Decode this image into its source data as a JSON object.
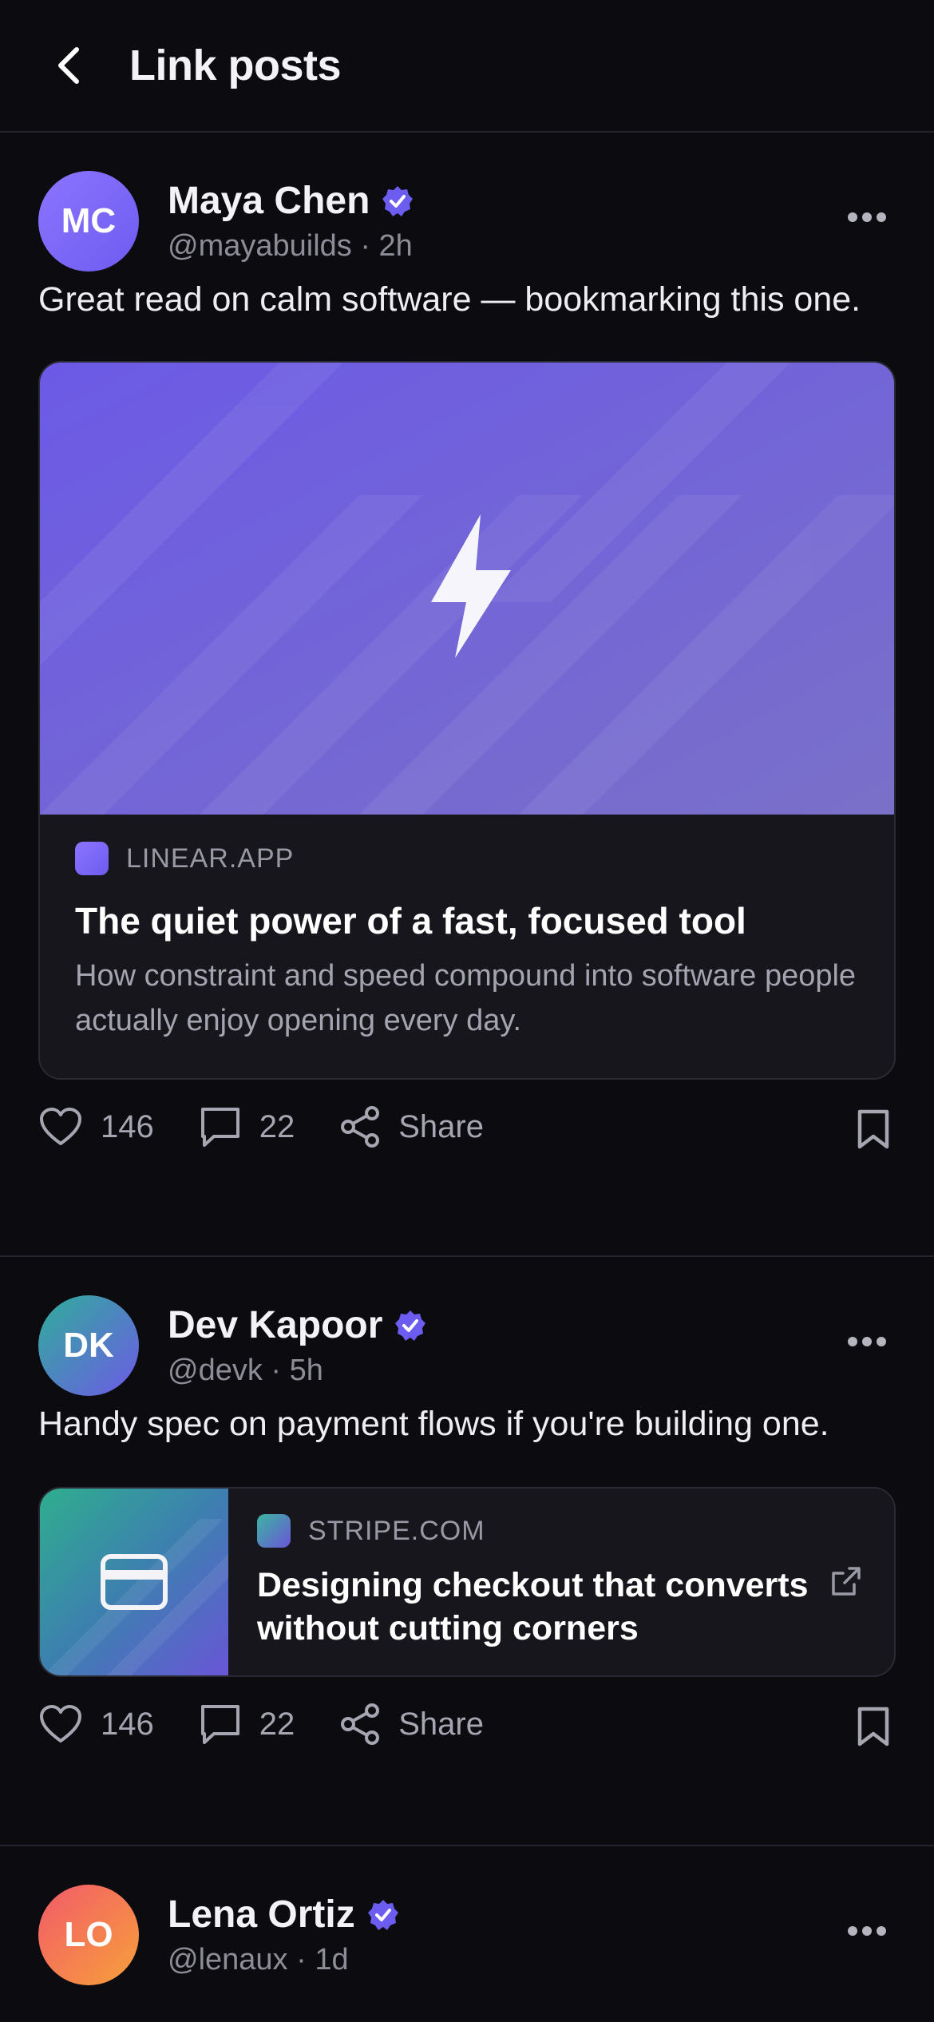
{
  "header": {
    "title": "Link posts"
  },
  "posts": [
    {
      "author": {
        "initials": "MC",
        "name": "Maya Chen",
        "handle": "@mayabuilds",
        "time": "2h",
        "handle_time": "@mayabuilds · 2h"
      },
      "text": "Great read on calm software — bookmarking this one.",
      "card": {
        "domain": "LINEAR.APP",
        "title": "The quiet power of a fast, focused tool",
        "description": "How constraint and speed compound into software people actually enjoy opening every day.",
        "icon": "lightning-icon"
      },
      "actions": {
        "likes": "146",
        "comments": "22",
        "share": "Share"
      }
    },
    {
      "author": {
        "initials": "DK",
        "name": "Dev Kapoor",
        "handle": "@devk",
        "time": "5h",
        "handle_time": "@devk · 5h"
      },
      "text": "Handy spec on payment flows if you're building one.",
      "card": {
        "domain": "STRIPE.COM",
        "title": "Designing checkout that converts without cutting corners",
        "icon": "credit-card-icon"
      },
      "actions": {
        "likes": "146",
        "comments": "22",
        "share": "Share"
      }
    },
    {
      "author": {
        "initials": "LO",
        "name": "Lena Ortiz",
        "handle": "@lenaux",
        "time": "1d",
        "handle_time": "@lenaux · 1d"
      }
    }
  ],
  "colors": {
    "accent": "#7b6cf6",
    "background": "#0b0b10",
    "verified": "#6d5cf0"
  }
}
